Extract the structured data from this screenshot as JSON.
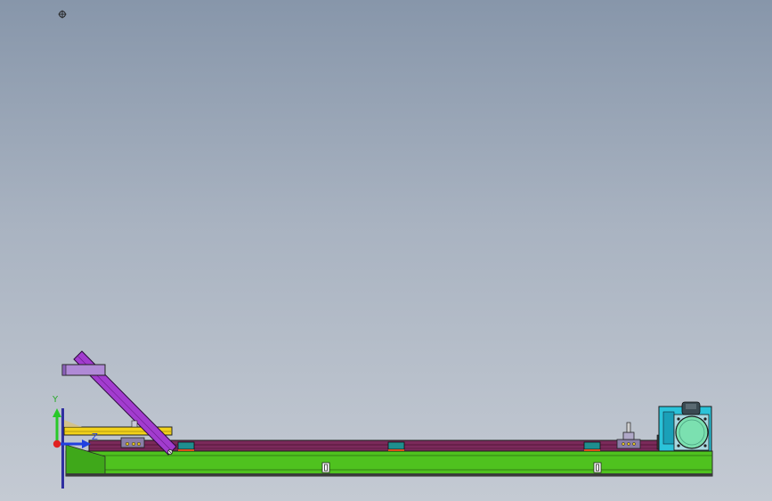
{
  "viewport": {
    "background_top": "#8796aa",
    "background_bottom": "#c4cad3"
  },
  "triad": {
    "y_label": "Y",
    "z_label": "Z",
    "colors": {
      "x": "#e02020",
      "y": "#28c828",
      "z": "#2040e0"
    }
  },
  "model": {
    "colors": {
      "base_beam": "#4fc21f",
      "rail": "#7a2a5a",
      "inclined_arm": "#a23ccf",
      "slide_plate": "#f2d21a",
      "motor_housing": "#2bc3d9",
      "motor_body": "#7be0b0",
      "block": "#1f8f8f",
      "mount": "#8a7fa8"
    }
  }
}
